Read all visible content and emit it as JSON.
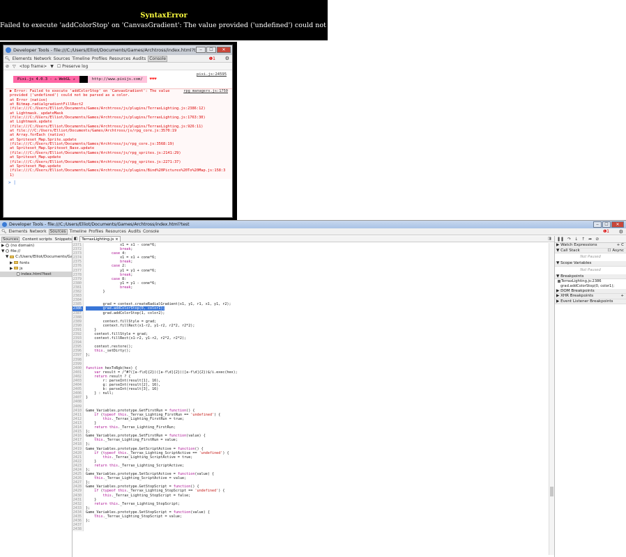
{
  "game_error": {
    "title": "SyntaxError",
    "message": "Failed to execute 'addColorStop' on 'CanvasGradient': The value provided ('undefined') could not be parsed as a color."
  },
  "console_window": {
    "title": "Developer Tools - file:///C:/Users/Elliot/Documents/Games/Archtross/index.html?test",
    "buttons": [
      "‒",
      "☐",
      "✕"
    ],
    "tabs": [
      "Elements",
      "Network",
      "Sources",
      "Timeline",
      "Profiles",
      "Resources",
      "Audits",
      "Console"
    ],
    "active_tab": "Console",
    "error_count": "❶1",
    "toolbar": {
      "frame": "<top frame>",
      "frame_arrow": "▼",
      "preserve_log": "Preserve log"
    },
    "pixi_link": "pixi.js:24595",
    "pixi_banner": {
      "part1": "Pixi.js 4.0.3 - ✰ WebGL ✰",
      "part2": "http://www.pixijs.com/",
      "part3": "♥♥♥"
    },
    "error_ref": "rpg_managers.js:1750",
    "error_lines": [
      "▶ Error: Failed to execute 'addColorStop' on 'CanvasGradient': The value",
      "provided ('undefined') could not be parsed as a color.",
      "    at Error (native)",
      "    at Bitmap.radialgradientFillRect2",
      "(file:///C:/Users/Elliot/Documents/Games/Archtross/js/plugins/TerraxLighting.js:2386:12)",
      "    at Lightmask._updateMask",
      "(file:///C:/Users/Elliot/Documents/Games/Archtross/js/plugins/TerraxLighting.js:1763:30)",
      "    at Lightmask.update",
      "(file:///C:/Users/Elliot/Documents/Games/Archtross/js/plugins/TerraxLighting.js:926:11)",
      "    at file:///C:/Users/Elliot/Documents/Games/Archtross/js/rpg_core.js:3570:19",
      "    at Array.forEach (native)",
      "    at Spriteset_Map.Sprite.update",
      "(file:///C:/Users/Elliot/Documents/Games/Archtross/js/rpg_core.js:3568:19)",
      "    at Spriteset_Map.Spriteset_Base.update",
      "(file:///C:/Users/Elliot/Documents/Games/Archtross/js/rpg_sprites.js:2141:29)",
      "    at Spriteset_Map.update",
      "(file:///C:/Users/Elliot/Documents/Games/Archtross/js/rpg_sprites.js:2271:37)",
      "    at Spriteset_Map.update",
      "(file:///C:/Users/Elliot/Documents/Games/Archtross/js/plugins/Bind%20Pictures%20To%20Map.js:158:3",
      "1)"
    ],
    "prompt": "> |"
  },
  "main_window": {
    "title": "Developer Tools - file:///C:/Users/Elliot/Documents/Games/Archtross/index.html?test",
    "buttons": [
      "‒",
      "☐",
      "✕"
    ],
    "tabs": [
      "Elements",
      "Network",
      "Sources",
      "Timeline",
      "Profiles",
      "Resources",
      "Audits",
      "Console"
    ],
    "active_tab": "Sources",
    "error_count": "❶1",
    "navigator": {
      "tabs": [
        "Sources",
        "Content scripts",
        "Snippets"
      ],
      "active_tab": "Sources",
      "tree": [
        {
          "label": "▶ (no domain)",
          "indent": 0,
          "icon": "globe"
        },
        {
          "label": "▼ file://",
          "indent": 0,
          "icon": "globe"
        },
        {
          "label": "▼ C:/Users/Elliot/Documents/Game",
          "indent": 6,
          "icon": "folder"
        },
        {
          "label": "▶ fonts",
          "indent": 12,
          "icon": "folder"
        },
        {
          "label": "▶ js",
          "indent": 12,
          "icon": "folder"
        },
        {
          "label": "index.html?test",
          "indent": 22,
          "icon": "file",
          "selected": true
        }
      ]
    },
    "editor": {
      "file_tab": "TerraxLighting.js ×",
      "code_lines": [
        [
          "2371",
          "                x1 = x1 - cone*6;"
        ],
        [
          "2372",
          "                break;"
        ],
        [
          "2373",
          "            case 4:"
        ],
        [
          "2374",
          "                x1 = x1 + cone*6;"
        ],
        [
          "2375",
          "                break;"
        ],
        [
          "2376",
          "            case 2:"
        ],
        [
          "2377",
          "                y1 = y1 + cone*6;"
        ],
        [
          "2378",
          "                break;"
        ],
        [
          "2379",
          "            case 8:"
        ],
        [
          "2380",
          "                y1 = y1 - cone*6;"
        ],
        [
          "2381",
          "                break;"
        ],
        [
          "2382",
          "        }"
        ],
        [
          "2383",
          ""
        ],
        [
          "2384",
          ""
        ],
        [
          "2385",
          "        grad = context.createRadialGradient(x1, y1, r1, x1, y1, r2);"
        ],
        [
          "2386",
          "        grad.addColorStop(0, color1);"
        ],
        [
          "2387",
          "        grad.addColorStop(1, color2);"
        ],
        [
          "2388",
          ""
        ],
        [
          "2389",
          "        context.fillStyle = grad;"
        ],
        [
          "2390",
          "        context.fillRect(x1-r2, y1-r2, r2*2, r2*2);"
        ],
        [
          "2391",
          "    }"
        ],
        [
          "2392",
          "    context.fillStyle = grad;"
        ],
        [
          "2393",
          "    context.fillRect(x1-r2, y1-r2, r2*2, r2*2);"
        ],
        [
          "2394",
          ""
        ],
        [
          "2395",
          "    context.restore();"
        ],
        [
          "2396",
          "    this._setDirty();"
        ],
        [
          "2397",
          "};"
        ],
        [
          "2398",
          ""
        ],
        [
          "2399",
          ""
        ],
        [
          "2400",
          "function hexToRgb(hex) {"
        ],
        [
          "2401",
          "    var result = /^#?([a-f\\d]{2})([a-f\\d]{2})([a-f\\d]{2})$/i.exec(hex);"
        ],
        [
          "2402",
          "    return result ? {"
        ],
        [
          "2403",
          "        r: parseInt(result[1], 16),"
        ],
        [
          "2404",
          "        g: parseInt(result[2], 16),"
        ],
        [
          "2405",
          "        b: parseInt(result[3], 16)"
        ],
        [
          "2406",
          "    } : null;"
        ],
        [
          "2407",
          "}"
        ],
        [
          "2408",
          ""
        ],
        [
          "2409",
          ""
        ],
        [
          "2410",
          "Game_Variables.prototype.GetFirstRun = function() {"
        ],
        [
          "2411",
          "    if (typeof this._Terrax_Lighting_FirstRun == 'undefined') {"
        ],
        [
          "2412",
          "        this._Terrax_Lighting_FirstRun = true;"
        ],
        [
          "2413",
          "    }"
        ],
        [
          "2414",
          "    return this._Terrax_Lighting_FirstRun;"
        ],
        [
          "2415",
          "};"
        ],
        [
          "2416",
          "Game_Variables.prototype.SetFirstRun = function(value) {"
        ],
        [
          "2417",
          "    this._Terrax_Lighting_FirstRun = value;"
        ],
        [
          "2418",
          "};"
        ],
        [
          "2419",
          "Game_Variables.prototype.GetScriptActive = function() {"
        ],
        [
          "2420",
          "    if (typeof this._Terrax_Lighting_ScriptActive == 'undefined') {"
        ],
        [
          "2421",
          "        this._Terrax_Lighting_ScriptActive = true;"
        ],
        [
          "2422",
          "    }"
        ],
        [
          "2423",
          "    return this._Terrax_Lighting_ScriptActive;"
        ],
        [
          "2424",
          "};"
        ],
        [
          "2425",
          "Game_Variables.prototype.SetScriptActive = function(value) {"
        ],
        [
          "2426",
          "    this._Terrax_Lighting_ScriptActive = value;"
        ],
        [
          "2427",
          "};"
        ],
        [
          "2428",
          "Game_Variables.prototype.GetStopScript = function() {"
        ],
        [
          "2429",
          "    if (typeof this._Terrax_Lighting_StopScript == 'undefined') {"
        ],
        [
          "2430",
          "        this._Terrax_Lighting_StopScript = false;"
        ],
        [
          "2431",
          "    }"
        ],
        [
          "2432",
          "    return this._Terrax_Lighting_StopScript;"
        ],
        [
          "2433",
          "};"
        ],
        [
          "2434",
          "Game_Variables.prototype.SetStopScript = function(value) {"
        ],
        [
          "2435",
          "    this._Terrax_Lighting_StopScript = value;"
        ],
        [
          "2436",
          "};"
        ],
        [
          "2437",
          ""
        ],
        [
          "2438",
          ""
        ]
      ],
      "highlighted_line": "2386",
      "status_text": "{ }  Line 2386, Column 1"
    },
    "debugger": {
      "toolbar_icons": [
        "❚❚",
        "↷",
        "↓",
        "↑",
        "➦",
        "⊘"
      ],
      "sections": [
        {
          "title": "▶ Watch Expressions",
          "right": "+ C"
        },
        {
          "title": "▼ Call Stack",
          "right": "☐ Async",
          "body": "Not Paused"
        },
        {
          "title": "▼ Scope Variables",
          "body": "Not Paused"
        },
        {
          "title": "▼ Breakpoints"
        }
      ],
      "breakpoint_file": "TerraxLighting.js:2386",
      "breakpoint_code": "grad.addColorStop(0, color1);",
      "sections_after": [
        {
          "title": "▶ DOM Breakpoints"
        },
        {
          "title": "▶ XHR Breakpoints",
          "right": "+"
        },
        {
          "title": "▶ Event Listener Breakpoints"
        }
      ]
    }
  }
}
